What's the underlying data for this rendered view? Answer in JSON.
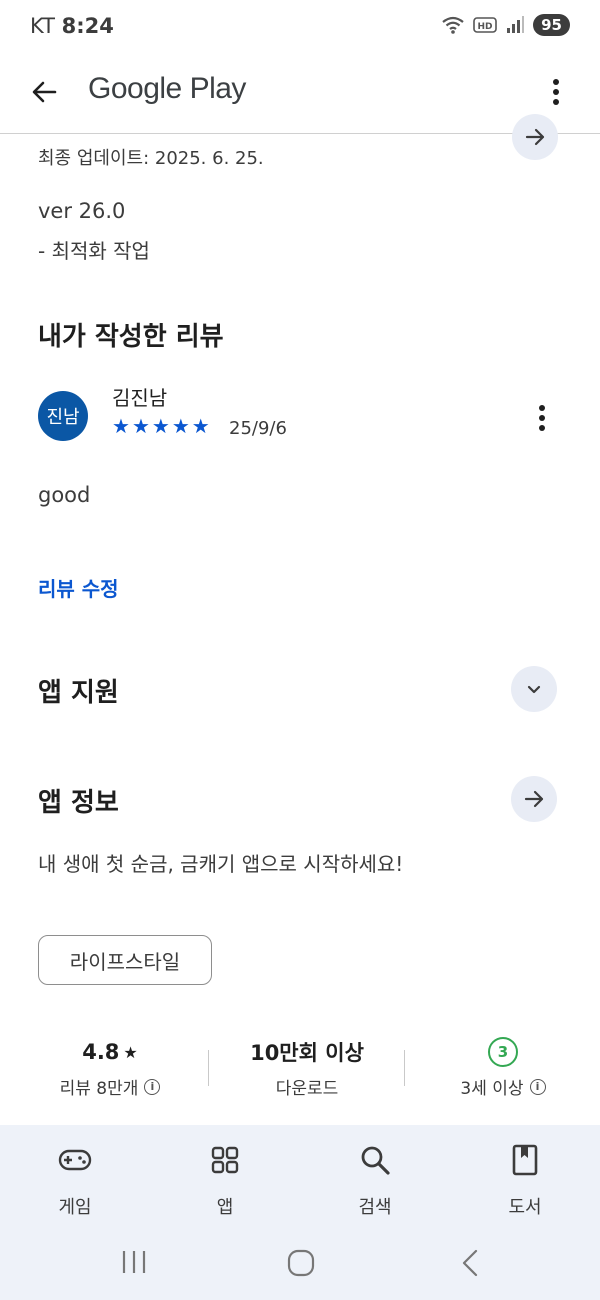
{
  "status_bar": {
    "carrier": "KT",
    "time": "8:24",
    "battery": "95"
  },
  "app_bar": {
    "title": "Google Play"
  },
  "update": {
    "last_updated": "최종 업데이트: 2025. 6. 25.",
    "version": "ver 26.0",
    "note": "- 최적화 작업"
  },
  "my_review": {
    "heading": "내가 작성한 리뷰",
    "avatar_text": "진남",
    "author": "김진남",
    "rating": 5,
    "date": "25/9/6",
    "body": "good",
    "edit_label": "리뷰 수정"
  },
  "app_support": {
    "heading": "앱 지원"
  },
  "app_info": {
    "heading": "앱 정보",
    "description": "내 생애 첫 순금, 금캐기 앱으로 시작하세요!",
    "category_chip": "라이프스타일"
  },
  "stats": {
    "rating_value": "4.8",
    "rating_label": "리뷰 8만개",
    "downloads_value": "10만회 이상",
    "downloads_label": "다운로드",
    "age_value": "3",
    "age_label": "3세 이상"
  },
  "bottom_nav": {
    "items": [
      {
        "label": "게임",
        "icon": "gamepad-icon"
      },
      {
        "label": "앱",
        "icon": "apps-grid-icon"
      },
      {
        "label": "검색",
        "icon": "search-icon"
      },
      {
        "label": "도서",
        "icon": "book-icon"
      }
    ]
  },
  "colors": {
    "accent": "#0b57d0",
    "avatar": "#0b57a5",
    "age_badge": "#34a853",
    "nav_bg": "#eef2f9",
    "circle_btn": "#e8ecf5"
  }
}
